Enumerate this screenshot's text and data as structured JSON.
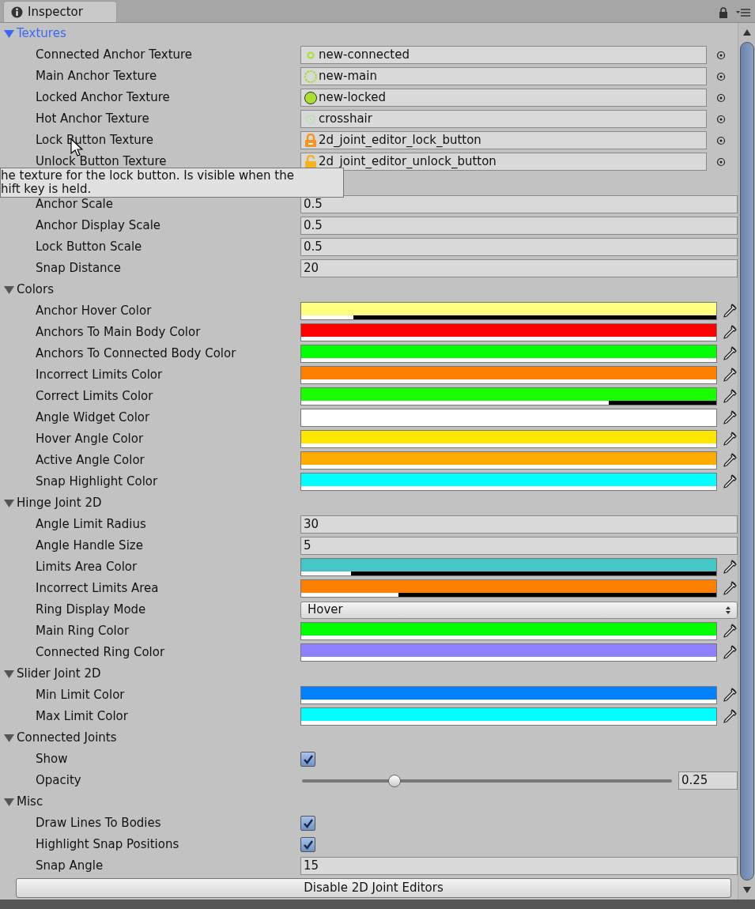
{
  "tab": {
    "title": "Inspector"
  },
  "sections": [
    {
      "title": "Textures",
      "expanded": true,
      "focused": true,
      "rows": [
        {
          "kind": "texture",
          "label": "Connected Anchor Texture",
          "value": "new-connected"
        },
        {
          "kind": "texture",
          "label": "Main Anchor Texture",
          "value": "new-main"
        },
        {
          "kind": "texture",
          "label": "Locked Anchor Texture",
          "value": "new-locked"
        },
        {
          "kind": "texture",
          "label": "Hot Anchor Texture",
          "value": "crosshair"
        },
        {
          "kind": "texture",
          "label": "Lock Button Texture",
          "value": "2d_joint_editor_lock_button"
        },
        {
          "kind": "texture",
          "label": "Unlock Button Texture",
          "value": "2d_joint_editor_unlock_button"
        }
      ]
    },
    {
      "rows": [
        {
          "kind": "number",
          "label": "Anchor Scale",
          "value": "0.5"
        },
        {
          "kind": "number",
          "label": "Anchor Display Scale",
          "value": "0.5"
        },
        {
          "kind": "number",
          "label": "Lock Button Scale",
          "value": "0.5"
        },
        {
          "kind": "number",
          "label": "Snap Distance",
          "value": "20"
        }
      ]
    },
    {
      "title": "Colors",
      "expanded": true,
      "focused": false,
      "rows": [
        {
          "kind": "color",
          "label": "Anchor Hover Color",
          "color": "#ffff80",
          "level": 0.125
        },
        {
          "kind": "color",
          "label": "Anchors To Main Body Color",
          "color": "#ff0000",
          "level": 1
        },
        {
          "kind": "color",
          "label": "Anchors To Connected Body Color",
          "color": "#00ff00",
          "level": 1
        },
        {
          "kind": "color",
          "label": "Incorrect Limits Color",
          "color": "#ff8000",
          "level": 1
        },
        {
          "kind": "color",
          "label": "Correct Limits Color",
          "color": "#1aff00",
          "level": 0.74
        },
        {
          "kind": "color",
          "label": "Angle Widget Color",
          "color": "#ffffff",
          "level": 1
        },
        {
          "kind": "color",
          "label": "Hover Angle Color",
          "color": "#ffe600",
          "level": 1
        },
        {
          "kind": "color",
          "label": "Active Angle Color",
          "color": "#ffab00",
          "level": 1
        },
        {
          "kind": "color",
          "label": "Snap Highlight Color",
          "color": "#00ffff",
          "level": 1
        }
      ]
    },
    {
      "title": "Hinge Joint 2D",
      "expanded": true,
      "focused": false,
      "rows": [
        {
          "kind": "number",
          "label": "Angle Limit Radius",
          "value": "30"
        },
        {
          "kind": "number",
          "label": "Angle Handle Size",
          "value": "5"
        },
        {
          "kind": "color",
          "label": "Limits Area Color",
          "color": "#45c6c6",
          "level": 0.12
        },
        {
          "kind": "color",
          "label": "Incorrect Limits Area",
          "color": "#ff8000",
          "level": 0.235
        },
        {
          "kind": "dropdown",
          "label": "Ring Display Mode",
          "value": "Hover"
        },
        {
          "kind": "color",
          "label": "Main Ring Color",
          "color": "#00ff00",
          "level": 1
        },
        {
          "kind": "color",
          "label": "Connected Ring Color",
          "color": "#8f80ff",
          "level": 1
        }
      ]
    },
    {
      "title": "Slider Joint 2D",
      "expanded": true,
      "focused": false,
      "rows": [
        {
          "kind": "color",
          "label": "Min Limit Color",
          "color": "#0080ff",
          "level": 1
        },
        {
          "kind": "color",
          "label": "Max Limit Color",
          "color": "#00ffff",
          "level": 1
        }
      ]
    },
    {
      "title": "Connected Joints",
      "expanded": true,
      "focused": false,
      "rows": [
        {
          "kind": "checkbox",
          "label": "Show",
          "checked": true
        },
        {
          "kind": "slider",
          "label": "Opacity",
          "level": 0.25,
          "value": "0.25"
        }
      ]
    },
    {
      "title": "Misc",
      "expanded": true,
      "focused": false,
      "rows": [
        {
          "kind": "checkbox",
          "label": "Draw Lines To Bodies",
          "checked": true
        },
        {
          "kind": "checkbox",
          "label": "Highlight Snap Positions",
          "checked": true
        },
        {
          "kind": "number",
          "label": "Snap Angle",
          "value": "15"
        }
      ]
    }
  ],
  "button": "Disable 2D Joint Editors",
  "tooltip": {
    "lines": [
      "he texture for the lock button. Is visible when the",
      "hift key is held."
    ]
  }
}
